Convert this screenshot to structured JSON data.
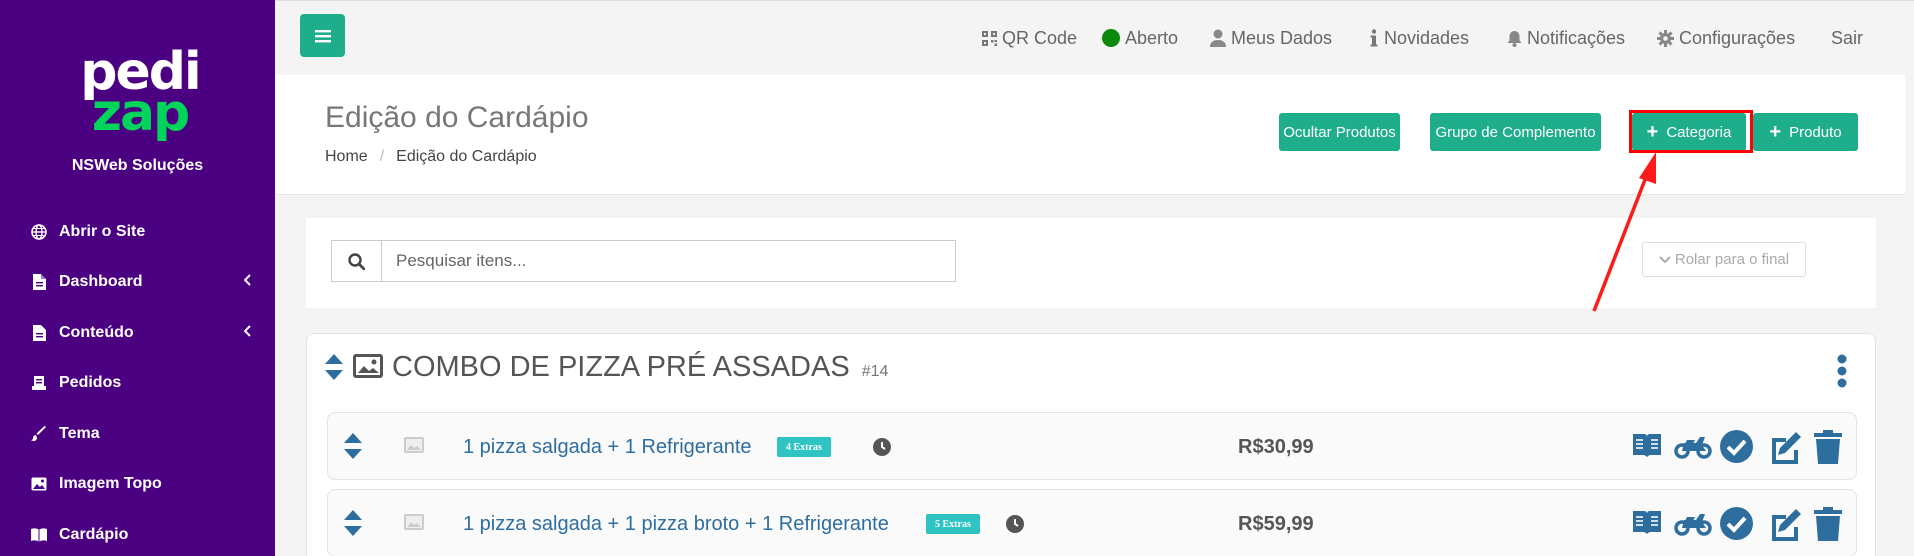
{
  "sidebar": {
    "logo": {
      "line1": "pedi",
      "line2": "zap"
    },
    "company": "NSWeb Soluções",
    "items": [
      {
        "label": "Abrir o Site",
        "icon": "globe-icon"
      },
      {
        "label": "Dashboard",
        "icon": "file-icon",
        "expandable": true
      },
      {
        "label": "Conteúdo",
        "icon": "file-icon",
        "expandable": true
      },
      {
        "label": "Pedidos",
        "icon": "orders-icon"
      },
      {
        "label": "Tema",
        "icon": "brush-icon"
      },
      {
        "label": "Imagem Topo",
        "icon": "image-icon"
      },
      {
        "label": "Cardápio",
        "icon": "book-icon"
      }
    ]
  },
  "topbar": {
    "qr": "QR Code",
    "status": "Aberto",
    "profile": "Meus Dados",
    "news": "Novidades",
    "notifications": "Notificações",
    "settings": "Configurações",
    "logout": "Sair"
  },
  "header": {
    "title": "Edição do Cardápio",
    "breadcrumb": {
      "home": "Home",
      "current": "Edição do Cardápio"
    },
    "buttons": {
      "hide_products": "Ocultar Produtos",
      "complement_group": "Grupo de Complemento",
      "category": "Categoria",
      "product": "Produto"
    }
  },
  "search": {
    "placeholder": "Pesquisar itens...",
    "scroll_button": "Rolar para o final"
  },
  "category": {
    "title": "COMBO DE PIZZA PRÉ ASSADAS",
    "id": "#14",
    "products": [
      {
        "name": "1 pizza salgada + 1 Refrigerante",
        "extras": "4 Extras",
        "price": "R$30,99"
      },
      {
        "name": "1 pizza salgada + 1 pizza broto + 1 Refrigerante",
        "extras": "5 Extras",
        "price": "R$59,99"
      }
    ]
  },
  "colors": {
    "sidebar_bg": "#4b0082",
    "accent": "#1fae8c",
    "logo_green": "#00d45a",
    "status_open": "#0a8a0a",
    "action_blue": "#2e6e9e",
    "highlight_red": "#ff0000",
    "badge": "#2ec4c4"
  }
}
